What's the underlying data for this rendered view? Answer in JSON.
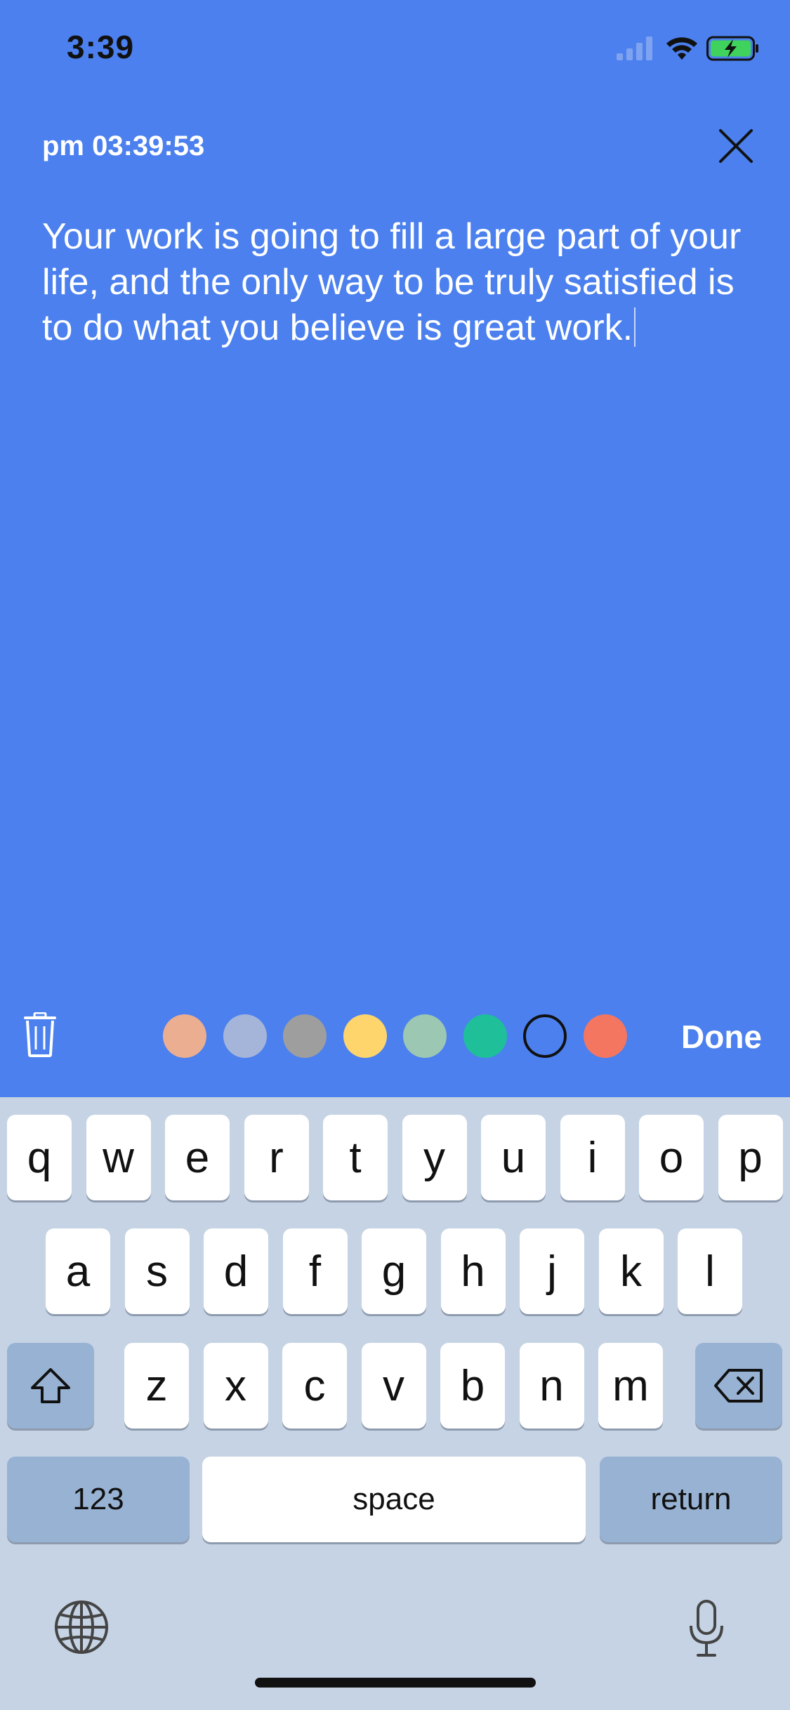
{
  "status_bar": {
    "time": "3:39"
  },
  "note": {
    "time": "pm 03:39:53",
    "text": "Your work is going to fill a large part of your life, and the only way to be truly satisfied is to do what you believe is great work."
  },
  "toolbar": {
    "done_label": "Done",
    "colors": [
      "#EBAE90",
      "#A5B5D9",
      "#9E9E9E",
      "#FDD56C",
      "#9CC7B3",
      "#1FBF9A",
      "#4B80EE",
      "#F47660"
    ],
    "selected_color_index": 6
  },
  "keyboard": {
    "row1": [
      "q",
      "w",
      "e",
      "r",
      "t",
      "y",
      "u",
      "i",
      "o",
      "p"
    ],
    "row2": [
      "a",
      "s",
      "d",
      "f",
      "g",
      "h",
      "j",
      "k",
      "l"
    ],
    "row3": [
      "z",
      "x",
      "c",
      "v",
      "b",
      "n",
      "m"
    ],
    "numbers_label": "123",
    "space_label": "space",
    "return_label": "return"
  },
  "icons": [
    "signal-icon",
    "wifi-icon",
    "battery-charging-icon",
    "close-icon",
    "trash-icon",
    "shift-icon",
    "backspace-icon",
    "globe-icon",
    "microphone-icon"
  ]
}
